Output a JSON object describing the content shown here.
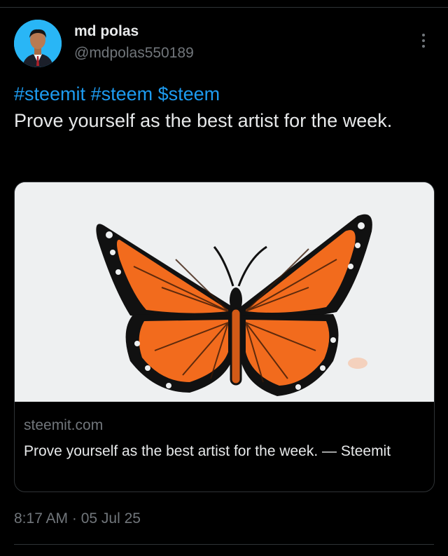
{
  "author": {
    "display_name": "md polas",
    "handle": "@mdpolas550189"
  },
  "post": {
    "hashtags": [
      "#steemit",
      "#steem",
      "$steem"
    ],
    "text": "Prove yourself as the best artist for the week."
  },
  "link_card": {
    "domain": "steemit.com",
    "title": "Prove yourself as the best artist for the week. — Steemit",
    "image": "butterfly-drawing"
  },
  "meta": {
    "timestamp": "8:17 AM · 05 Jul 25"
  },
  "colors": {
    "accent": "#1d9bf0",
    "background": "#000000",
    "wing_orange": "#f26b1d"
  }
}
